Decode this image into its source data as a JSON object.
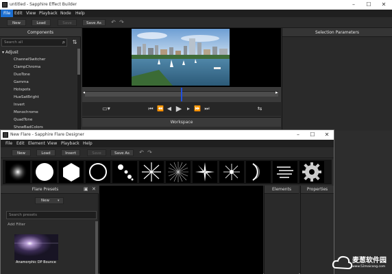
{
  "main_window": {
    "title": "untitled - Sapphire Effect Builder",
    "menu": [
      "File",
      "Edit",
      "View",
      "Playback",
      "Node",
      "Help"
    ],
    "toolbar": {
      "new": "New",
      "load": "Load",
      "save": "Save",
      "save_as": "Save As"
    },
    "components": {
      "header": "Components",
      "search_placeholder": "Search all",
      "category": "Adjust",
      "items": [
        "ChannelSwitcher",
        "ClampChroma",
        "DuoTone",
        "Gamma",
        "Hotspots",
        "HueSatBright",
        "Invert",
        "Monochrome",
        "QuadTone",
        "ShowBadColors"
      ]
    },
    "workspace_header": "Workspace",
    "selection_params_header": "Selection Parameters"
  },
  "flare_window": {
    "title": "New Flare - Sapphire Flare Designer",
    "menu": [
      "File",
      "Edit",
      "Element",
      "View",
      "Playback",
      "Help"
    ],
    "toolbar": {
      "new": "New",
      "load": "Load",
      "insert": "Insert",
      "save": "Save",
      "save_as": "Save As"
    },
    "presets_panel": {
      "header": "Flare Presets",
      "dropdown": "New",
      "search_placeholder": "Search presets",
      "add_filter": "Add Filter",
      "thumb_caption": "Anamorphic DP Bounce"
    },
    "elements_header": "Elements",
    "properties_header": "Properties"
  },
  "watermark": {
    "brand": "麦葱软件园",
    "url": "www.52maicong.com"
  },
  "colors": {
    "accent_blue": "#1c6fd1",
    "playhead": "#2050e0",
    "panel_bg": "#2a2a2a"
  }
}
